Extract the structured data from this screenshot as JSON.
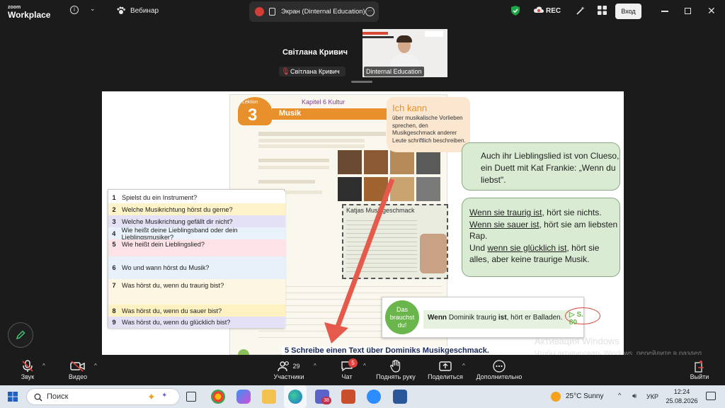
{
  "topbar": {
    "logo_small": "zoom",
    "logo_main": "Workplace",
    "meeting_name": "Вебинар",
    "share_title": "Экран (Dinternal Education)",
    "rec_label": "REC",
    "login_label": "Вход"
  },
  "video": {
    "speaker_name": "Світлана Кривич",
    "speaker_tag": "Світлана Кривич",
    "cam_name": "Dinternal Education"
  },
  "slide": {
    "lektion_label": "Lektion",
    "lektion_number": "3",
    "kapitel": "Kapitel 6 Kultur",
    "musik": "Musik",
    "ich_kann_title": "Ich kann",
    "ich_kann_text": "über musikalische Vorlieben sprechen, den Musikgeschmack anderer Leute schriftlich beschreiben.",
    "bubble1": "Auch ihr Lieblingslied ist von Clueso, ein Duett mit Kat Frankie: „Wenn du liebst\".",
    "bubble2": {
      "l1a": "Wenn sie traurig ist",
      "l1b": ", hört sie nichts.",
      "l2a": "Wenn sie sauer ist",
      "l2b": ", hört sie am liebsten Rap.",
      "l3a": "Und ",
      "l3b": "wenn sie glücklich ist",
      "l3c": ", hört sie alles, aber keine traurige Musik."
    },
    "katjas_title": "Katjas Musikgeschmack",
    "questions": [
      {
        "n": "1",
        "t": "Spielst du ein Instrument?"
      },
      {
        "n": "2",
        "t": "Welche Musikrichtung hörst du gerne?"
      },
      {
        "n": "3",
        "t": "Welche Musikrichtung gefällt dir nicht?"
      },
      {
        "n": "4",
        "t": "Wie heißt deine Lieblingsband oder dein Lieblingsmusiker?"
      },
      {
        "n": "5",
        "t": "Wie heißt dein Lieblingslied?"
      },
      {
        "n": "6",
        "t": "Wo und wann hörst du Musik?"
      },
      {
        "n": "7",
        "t": "Was hörst du, wenn du traurig bist?"
      },
      {
        "n": "8",
        "t": "Was hörst du, wenn du sauer bist?"
      },
      {
        "n": "9",
        "t": "Was hörst du, wenn du glücklich bist?"
      }
    ],
    "brauchst_line1": "Das",
    "brauchst_line2": "brauchst",
    "brauchst_line3": "du!",
    "brauchst_example_a": "Wenn",
    "brauchst_example_b": " Dominik traurig ",
    "brauchst_example_c": "ist",
    "brauchst_example_d": ", hört er Balladen.",
    "page_ref": "▷ S. 80",
    "task5": "5  Schreibe einen Text über Dominiks Musikgeschmack."
  },
  "activate": {
    "title": "Активация Windows",
    "text": "Чтобы активировать Windows, перейдите в раздел \"Параметры\"."
  },
  "zoombar": {
    "audio": "Звук",
    "video": "Видео",
    "participants": "Участники",
    "participants_count": "29",
    "chat": "Чат",
    "chat_badge": "5",
    "raise_hand": "Поднять руку",
    "share": "Поделиться",
    "more": "Дополнительно",
    "leave": "Выйти"
  },
  "taskbar": {
    "search_placeholder": "Поиск",
    "weather": "25°C  Sunny",
    "lang": "УКР",
    "time": "12:24",
    "date": "25.08.2026",
    "teams_badge": "38"
  }
}
